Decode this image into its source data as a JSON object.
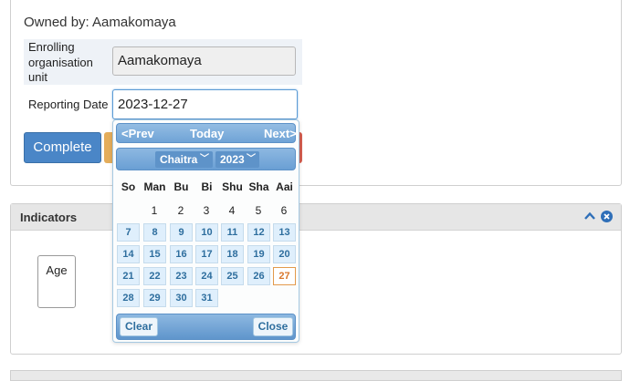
{
  "owner": {
    "text": "Owned by: Aamakomaya"
  },
  "form": {
    "org_label": "Enrolling organisation unit",
    "org_value": "Aamakomaya",
    "date_label": "Reporting Date",
    "date_value": "2023-12-27"
  },
  "buttons": {
    "complete": "Complete"
  },
  "indicators": {
    "title": "Indicators",
    "age_label": "Age"
  },
  "datepicker": {
    "prev": "<Prev",
    "today": "Today",
    "next": "Next>",
    "month": "Chaitra",
    "year": "2023",
    "weekdays": [
      "So",
      "Man",
      "Bu",
      "Bi",
      "Shu",
      "Sha",
      "Aai"
    ],
    "header_days": [
      "1",
      "2",
      "3",
      "4",
      "5",
      "6"
    ],
    "week2": [
      "7",
      "8",
      "9",
      "10",
      "11",
      "12",
      "13"
    ],
    "week3": [
      "14",
      "15",
      "16",
      "17",
      "18",
      "19",
      "20"
    ],
    "week4": [
      "21",
      "22",
      "23",
      "24",
      "25",
      "26",
      "27"
    ],
    "week5": [
      "28",
      "29",
      "30",
      "31"
    ],
    "selected_day": "27",
    "clear": "Clear",
    "close": "Close"
  },
  "colors": {
    "accent": "#4a86c7",
    "today": "#d9782d",
    "header_bg": "#e6e6e6"
  },
  "icons": {
    "collapse": "chevron-up-icon",
    "close": "close-circle-icon"
  }
}
